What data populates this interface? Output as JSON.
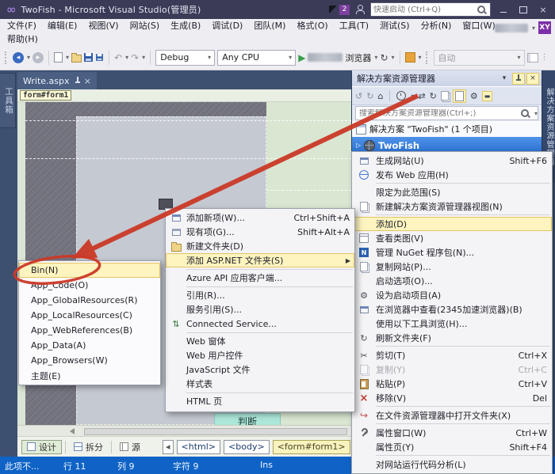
{
  "title_bar": {
    "logo_glyph": "∞",
    "title": "TwoFish - Microsoft Visual Studio(管理员)",
    "notification_count": "2",
    "quick_launch_placeholder": "快速启动 (Ctrl+Q)",
    "close": "×"
  },
  "menu_bar": {
    "row1": [
      "文件(F)",
      "编辑(E)",
      "视图(V)",
      "网站(S)",
      "生成(B)",
      "调试(D)",
      "团队(M)",
      "格式(O)",
      "工具(T)",
      "测试(S)",
      "分析(N)",
      "窗口(W)"
    ],
    "row2": [
      "帮助(H)"
    ],
    "account_initials": "XY"
  },
  "toolbar": {
    "debug_config": "Debug",
    "platform": "Any CPU",
    "browser_suffix": "浏览器",
    "auto_label": "自动"
  },
  "toolbox": {
    "tab": "工具箱"
  },
  "editor": {
    "tab": "Write.aspx",
    "breadcrumb": "form#form1",
    "design_button": "判断",
    "modes": [
      "设计",
      "拆分",
      "源"
    ],
    "tags": [
      "<html>",
      "<body>",
      "<form#form1>"
    ]
  },
  "solution_explorer": {
    "title": "解决方案资源管理器",
    "search_placeholder": "搜索解决方案资源管理器(Ctrl+;)",
    "solution": "解决方案 \"TwoFish\" (1 个项目)",
    "project": "TwoFish",
    "side_tab": "解决方案资源管理器"
  },
  "project_menu": {
    "items": [
      {
        "label": "生成网站(U)",
        "shortcut": "Shift+F6"
      },
      {
        "label": "发布 Web 应用(H)",
        "shortcut": ""
      },
      {
        "label": "限定为此范围(S)",
        "shortcut": ""
      },
      {
        "label": "新建解决方案资源管理器视图(N)",
        "shortcut": ""
      },
      {
        "label": "添加(D)",
        "shortcut": ""
      },
      {
        "label": "查看类图(V)",
        "shortcut": ""
      },
      {
        "label": "管理 NuGet 程序包(N)...",
        "shortcut": ""
      },
      {
        "label": "复制网站(P)...",
        "shortcut": ""
      },
      {
        "label": "启动选项(O)...",
        "shortcut": ""
      },
      {
        "label": "设为启动项目(A)",
        "shortcut": ""
      },
      {
        "label": "在浏览器中查看(2345加速浏览器)(B)",
        "shortcut": ""
      },
      {
        "label": "使用以下工具浏览(H)...",
        "shortcut": ""
      },
      {
        "label": "刷新文件夹(F)",
        "shortcut": ""
      },
      {
        "label": "剪切(T)",
        "shortcut": "Ctrl+X"
      },
      {
        "label": "复制(Y)",
        "shortcut": "Ctrl+C"
      },
      {
        "label": "粘贴(P)",
        "shortcut": "Ctrl+V"
      },
      {
        "label": "移除(V)",
        "shortcut": "Del"
      },
      {
        "label": "在文件资源管理器中打开文件夹(X)",
        "shortcut": ""
      },
      {
        "label": "属性窗口(W)",
        "shortcut": "Ctrl+W"
      },
      {
        "label": "属性页(Y)",
        "shortcut": "Shift+F4"
      },
      {
        "label": "对网站运行代码分析(L)",
        "shortcut": ""
      }
    ]
  },
  "add_menu": {
    "items": [
      {
        "label": "添加新项(W)...",
        "shortcut": "Ctrl+Shift+A"
      },
      {
        "label": "现有项(G)...",
        "shortcut": "Shift+Alt+A"
      },
      {
        "label": "新建文件夹(D)",
        "shortcut": ""
      },
      {
        "label": "添加 ASP.NET 文件夹(S)",
        "shortcut": ""
      },
      {
        "label": "Azure API 应用客户端...",
        "shortcut": ""
      },
      {
        "label": "引用(R)...",
        "shortcut": ""
      },
      {
        "label": "服务引用(S)...",
        "shortcut": ""
      },
      {
        "label": "Connected Service...",
        "shortcut": ""
      },
      {
        "label": "Web 窗体",
        "shortcut": ""
      },
      {
        "label": "Web 用户控件",
        "shortcut": ""
      },
      {
        "label": "JavaScript 文件",
        "shortcut": ""
      },
      {
        "label": "样式表",
        "shortcut": ""
      },
      {
        "label": "HTML 页",
        "shortcut": ""
      }
    ]
  },
  "aspnet_folder_submenu": {
    "items": [
      "Bin(N)",
      "App_Code(O)",
      "App_GlobalResources(R)",
      "App_LocalResources(C)",
      "App_WebReferences(B)",
      "App_Data(A)",
      "App_Browsers(W)",
      "主题(E)"
    ]
  },
  "status_bar": {
    "message": "此项不...",
    "line": "行 11",
    "column": "列 9",
    "character": "字符 9",
    "mode": "Ins"
  },
  "glyphs": {
    "dropdown": "▾",
    "play": "▶",
    "back": "◂",
    "forward": "▸",
    "undo": "↶",
    "redo": "↷",
    "refresh": "↻",
    "home": "⌂",
    "sync": "⇄",
    "nav_back": "↺",
    "nav_fwd": "↻",
    "cut": "✂",
    "gear": "⚙",
    "open_in_explorer": "↪",
    "remove": "×",
    "expand": "▷",
    "submenu_arrow": "▶",
    "scroll_left": "◂",
    "dash": "▬",
    "plug": "⇅",
    "nuget": "N",
    "overflow": "⋮"
  },
  "colors": {
    "annotation_red": "#CB3927",
    "menu_highlight": "#FDF4BF",
    "selection_blue": "#2B70D2",
    "status_blue": "#0F63C6",
    "title_bar": "#3B3B58"
  }
}
